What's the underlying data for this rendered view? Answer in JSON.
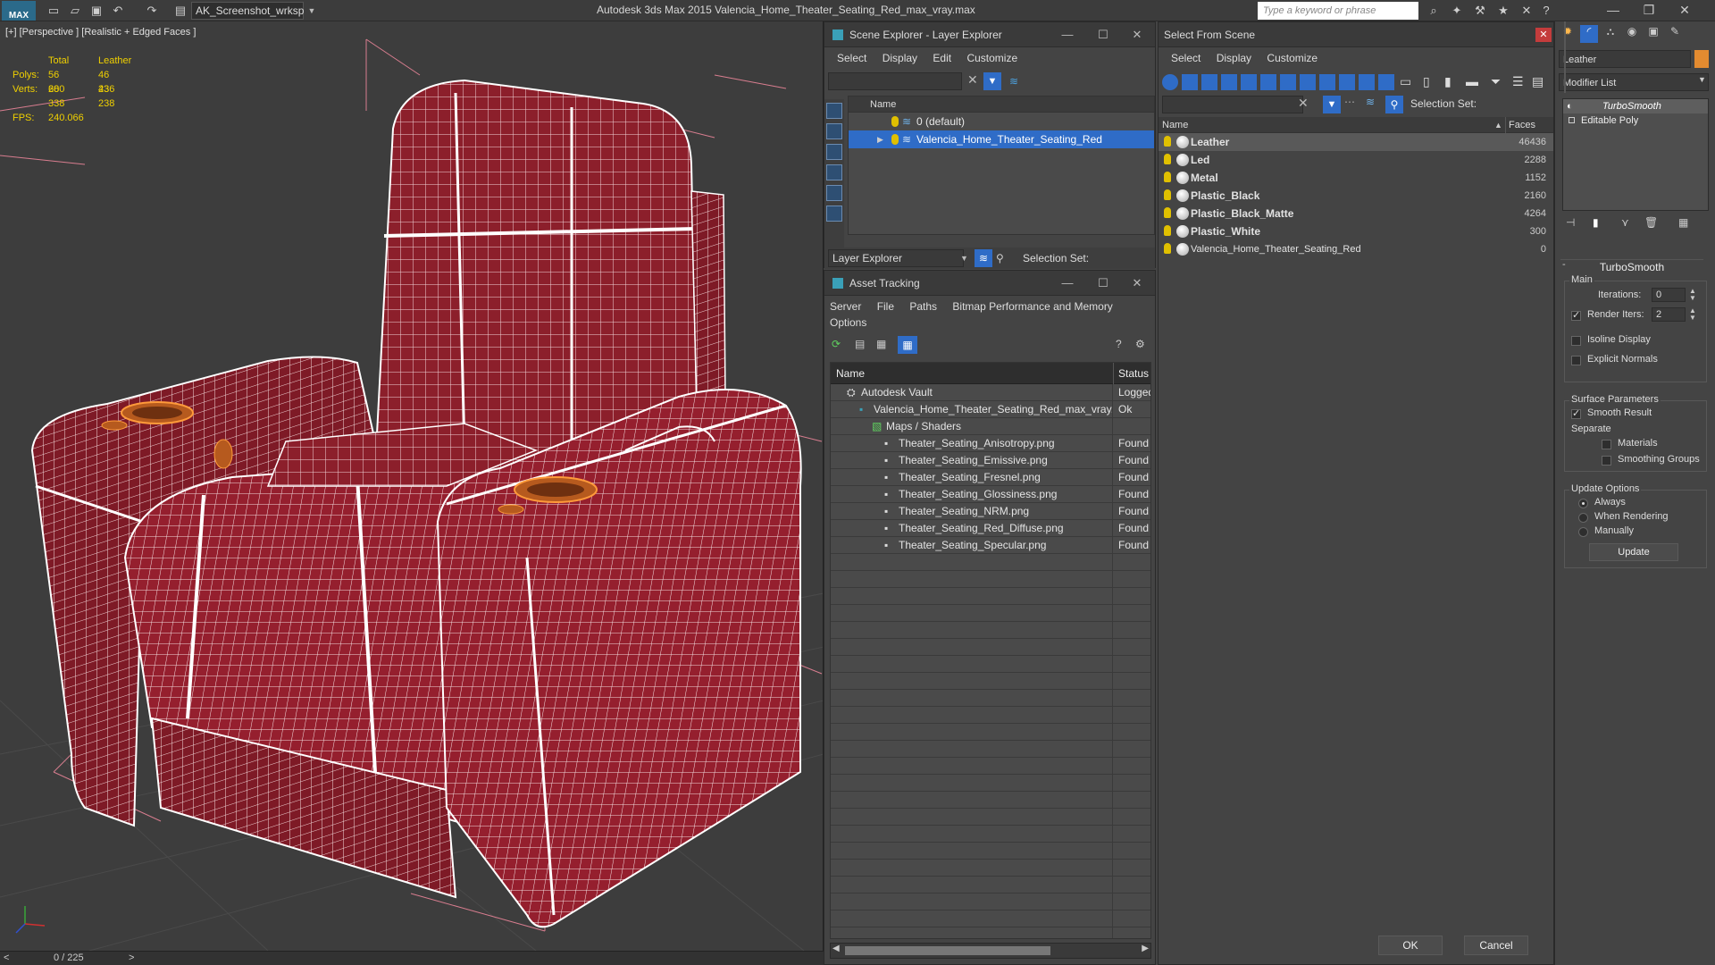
{
  "titlebar": {
    "workspace": "AK_Screenshot_wrksp",
    "app_title": "Autodesk 3ds Max  2015     Valencia_Home_Theater_Seating_Red_max_vray.max",
    "search_placeholder": "Type a keyword or phrase",
    "logo": "MAX"
  },
  "viewport": {
    "label": "[+] [Perspective ] [Realistic + Edged Faces ]",
    "stats": {
      "col_total": "Total",
      "col_leather": "Leather",
      "polys_label": "Polys:",
      "polys_total": "56 600",
      "polys_leather": "46 436",
      "verts_label": "Verts:",
      "verts_total": "28 338",
      "verts_leather": "23 238",
      "fps_label": "FPS:",
      "fps_value": "240.066"
    },
    "timeline": "0 / 225"
  },
  "scene_explorer": {
    "title": "Scene Explorer - Layer Explorer",
    "menu": [
      "Select",
      "Display",
      "Edit",
      "Customize"
    ],
    "col_name": "Name",
    "layers": [
      {
        "name": "0 (default)",
        "selected": false
      },
      {
        "name": "Valencia_Home_Theater_Seating_Red",
        "selected": true
      }
    ],
    "explorer_select": "Layer Explorer",
    "selection_set_label": "Selection Set:"
  },
  "asset_tracking": {
    "title": "Asset Tracking",
    "menu": [
      "Server",
      "File",
      "Paths",
      "Bitmap Performance and Memory"
    ],
    "menu2": "Options",
    "col_name": "Name",
    "col_status": "Status",
    "rows": [
      {
        "name": "Autodesk Vault",
        "status": "Logged",
        "indent": 0
      },
      {
        "name": "Valencia_Home_Theater_Seating_Red_max_vray...",
        "status": "Ok",
        "indent": 1
      },
      {
        "name": "Maps / Shaders",
        "status": "",
        "indent": 2
      },
      {
        "name": "Theater_Seating_Anisotropy.png",
        "status": "Found",
        "indent": 3
      },
      {
        "name": "Theater_Seating_Emissive.png",
        "status": "Found",
        "indent": 3
      },
      {
        "name": "Theater_Seating_Fresnel.png",
        "status": "Found",
        "indent": 3
      },
      {
        "name": "Theater_Seating_Glossiness.png",
        "status": "Found",
        "indent": 3
      },
      {
        "name": "Theater_Seating_NRM.png",
        "status": "Found",
        "indent": 3
      },
      {
        "name": "Theater_Seating_Red_Diffuse.png",
        "status": "Found",
        "indent": 3
      },
      {
        "name": "Theater_Seating_Specular.png",
        "status": "Found",
        "indent": 3
      }
    ]
  },
  "select_from_scene": {
    "title": "Select From Scene",
    "menu": [
      "Select",
      "Display",
      "Customize"
    ],
    "selection_set_label": "Selection Set:",
    "col_name": "Name",
    "col_faces": "Faces",
    "objects": [
      {
        "name": "Leather",
        "faces": "46436",
        "selected": true,
        "bold": true
      },
      {
        "name": "Led",
        "faces": "2288",
        "selected": false,
        "bold": true
      },
      {
        "name": "Metal",
        "faces": "1152",
        "selected": false,
        "bold": true
      },
      {
        "name": "Plastic_Black",
        "faces": "2160",
        "selected": false,
        "bold": true
      },
      {
        "name": "Plastic_Black_Matte",
        "faces": "4264",
        "selected": false,
        "bold": true
      },
      {
        "name": "Plastic_White",
        "faces": "300",
        "selected": false,
        "bold": true
      },
      {
        "name": "Valencia_Home_Theater_Seating_Red",
        "faces": "0",
        "selected": false,
        "bold": false
      }
    ],
    "ok_label": "OK",
    "cancel_label": "Cancel"
  },
  "command_panel": {
    "object_name": "Leather",
    "modifier_list": "Modifier List",
    "stack": [
      "TurboSmooth",
      "Editable Poly"
    ],
    "rollout_title": "TurboSmooth",
    "main_label": "Main",
    "iterations_label": "Iterations:",
    "iterations_value": "0",
    "render_iters_label": "Render Iters:",
    "render_iters_value": "2",
    "isoline_label": "Isoline Display",
    "explicit_normals_label": "Explicit Normals",
    "surface_params_label": "Surface Parameters",
    "smooth_result_label": "Smooth Result",
    "separate_label": "Separate",
    "materials_label": "Materials",
    "smoothing_groups_label": "Smoothing Groups",
    "update_options_label": "Update Options",
    "always_label": "Always",
    "when_rendering_label": "When Rendering",
    "manually_label": "Manually",
    "update_button": "Update"
  },
  "colors": {
    "selection_blue": "#2f6cc7",
    "stats_yellow": "#f0d000",
    "leather_red": "#8c1f2b",
    "wire_white": "#ffffff"
  }
}
